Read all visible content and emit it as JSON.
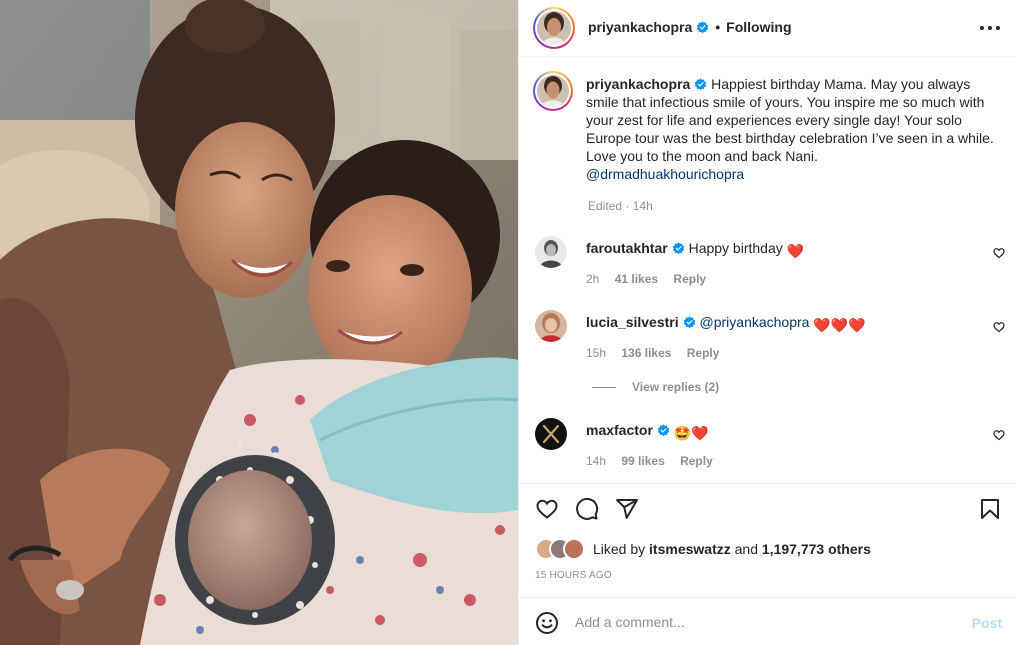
{
  "post": {
    "author": "priyankachopra",
    "separator": "•",
    "follow_status": "Following",
    "more_icon": "more-horizontal-icon"
  },
  "caption": {
    "author": "priyankachopra",
    "text": "Happiest birthday Mama. May you always smile that infectious smile of yours. You inspire me so much with your zest for life and experiences every single day! Your solo Europe tour was the best birthday celebration I’ve seen in a while. Love you to the moon and back Nani.",
    "mention": "@drmadhuakhourichopra",
    "edited": "Edited",
    "meta_sep": "·",
    "age": "14h"
  },
  "comments": [
    {
      "user": "faroutakhtar",
      "text": "Happy birthday",
      "emoji": "❤️",
      "age": "2h",
      "likes": "41 likes",
      "reply": "Reply"
    },
    {
      "user": "lucia_silvestri",
      "text": "@priyankachopra",
      "emoji": "❤️❤️❤️",
      "age": "15h",
      "likes": "136 likes",
      "reply": "Reply",
      "view_replies": "View replies (2)"
    },
    {
      "user": "maxfactor",
      "text": "",
      "emoji": "🤩❤️",
      "age": "14h",
      "likes": "99 likes",
      "reply": "Reply"
    }
  ],
  "likes": {
    "prefix": "Liked by",
    "user": "itsmeswatzz",
    "middle": "and",
    "count": "1,197,773 others"
  },
  "timestamp": "15 HOURS AGO",
  "comment_box": {
    "placeholder": "Add a comment...",
    "post_label": "Post"
  },
  "colors": {
    "text": "#262626",
    "muted": "#8e8e8e",
    "verified": "#0095f6",
    "mention": "#00376b",
    "post_disabled": "#b2dffc",
    "heart": "#ed4956"
  }
}
